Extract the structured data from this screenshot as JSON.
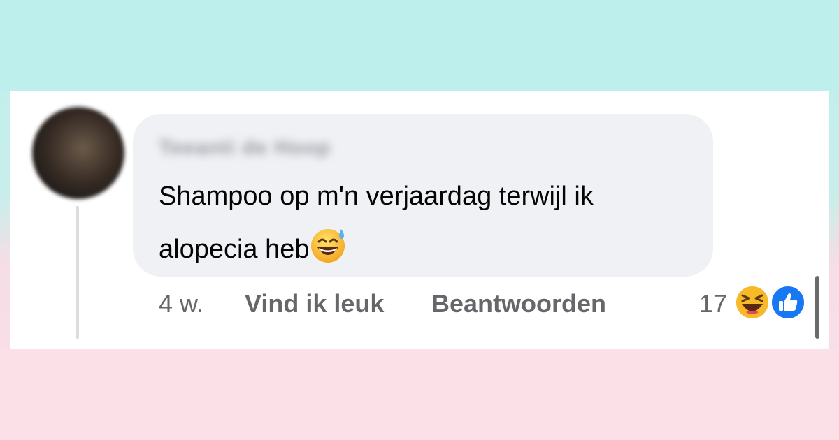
{
  "comment": {
    "author": "Teeanti de Hoop",
    "text_line1": "Shampoo op m'n verjaardag terwijl ik",
    "text_line2": "alopecia heb",
    "emoji": "grinning-face-with-sweat"
  },
  "actions": {
    "time": "4 w.",
    "like_label": "Vind ik leuk",
    "reply_label": "Beantwoorden"
  },
  "reactions": {
    "count": "17",
    "types": [
      "laughing-face-icon",
      "thumbs-up-icon"
    ],
    "colors": {
      "like": "#1877f2",
      "laugh": "#f7b928"
    }
  }
}
